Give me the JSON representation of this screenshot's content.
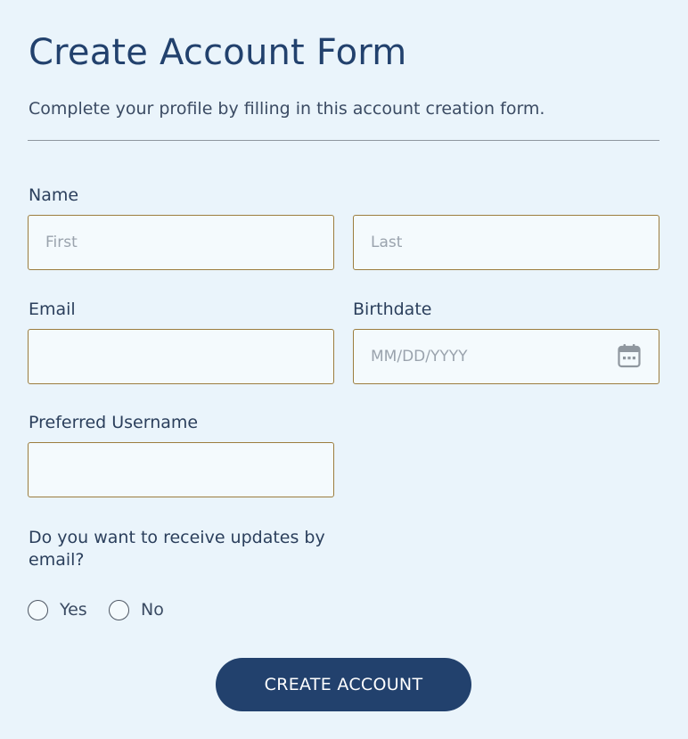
{
  "form": {
    "title": "Create Account Form",
    "subtitle": "Complete your profile by filling in this account creation form.",
    "name": {
      "label": "Name",
      "first_placeholder": "First",
      "last_placeholder": "Last"
    },
    "email": {
      "label": "Email",
      "value": ""
    },
    "birthdate": {
      "label": "Birthdate",
      "placeholder": "MM/DD/YYYY",
      "icon": "calendar-icon"
    },
    "username": {
      "label": "Preferred Username",
      "value": ""
    },
    "updates_question": {
      "label": "Do you want to receive updates by email?",
      "options": [
        {
          "label": "Yes",
          "selected": false
        },
        {
          "label": "No",
          "selected": false
        }
      ]
    },
    "submit_label": "CREATE ACCOUNT"
  },
  "colors": {
    "background": "#eaf4fb",
    "accent": "#22416d",
    "field_border": "#9c7d3e",
    "field_background": "#f4fafd"
  }
}
